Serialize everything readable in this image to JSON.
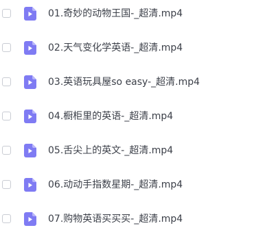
{
  "files": [
    {
      "name": "01.奇妙的动物王国-_超清.mp4",
      "icon": "video-file-icon",
      "checked": false
    },
    {
      "name": "02.天气变化学英语-_超清.mp4",
      "icon": "video-file-icon",
      "checked": false
    },
    {
      "name": "03.英语玩具屋so easy-_超清.mp4",
      "icon": "video-file-icon",
      "checked": false
    },
    {
      "name": "04.橱柜里的英语-_超清.mp4",
      "icon": "video-file-icon",
      "checked": false
    },
    {
      "name": "05.舌尖上的英文-_超清.mp4",
      "icon": "video-file-icon",
      "checked": false
    },
    {
      "name": "06.动动手指数星期-_超清.mp4",
      "icon": "video-file-icon",
      "checked": false
    },
    {
      "name": "07.购物英语买买买-_超清.mp4",
      "icon": "video-file-icon",
      "checked": false
    }
  ],
  "colors": {
    "icon_body": "#7f7bf3",
    "icon_fold": "#b9b6fa",
    "icon_play": "#ffffff",
    "text": "#3b3f48",
    "checkbox_border": "#c9ccd3"
  }
}
